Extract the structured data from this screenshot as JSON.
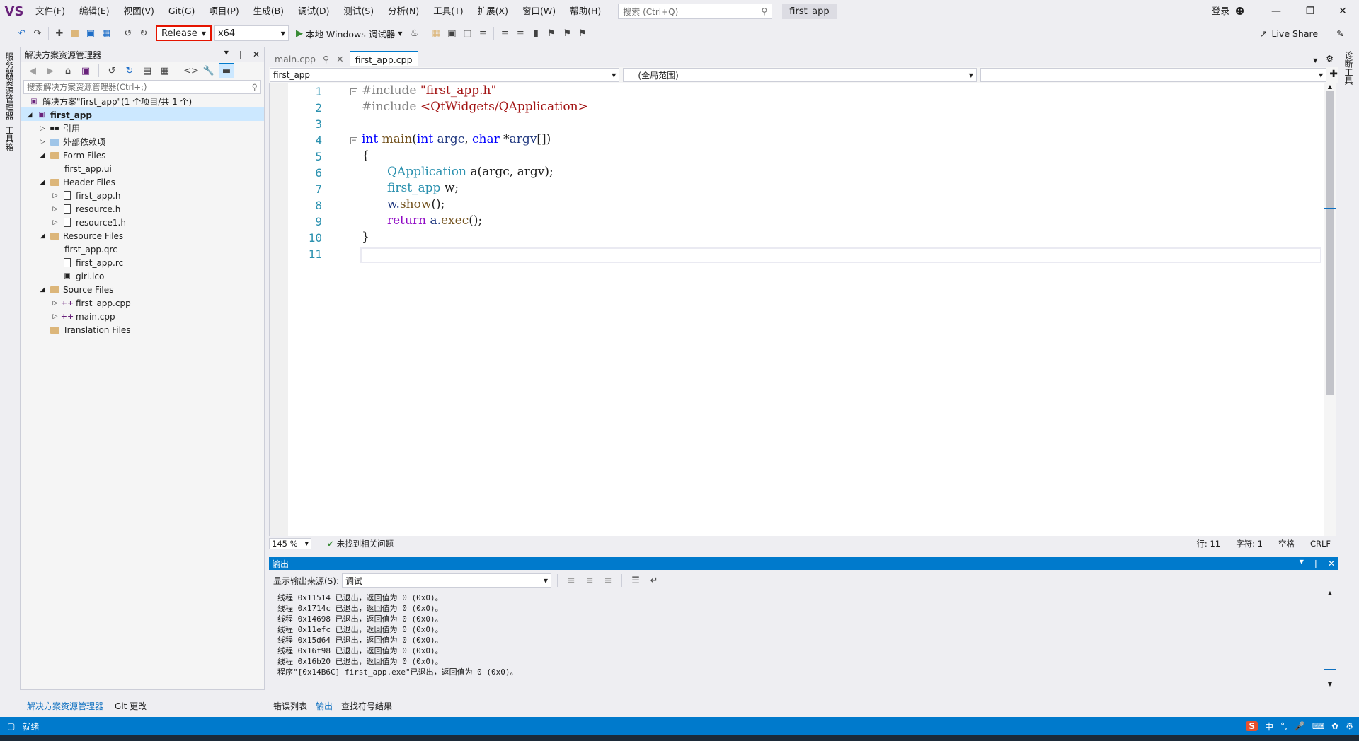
{
  "menubar": {
    "logo": "VS",
    "items": [
      "文件(F)",
      "编辑(E)",
      "视图(V)",
      "Git(G)",
      "项目(P)",
      "生成(B)",
      "调试(D)",
      "测试(S)",
      "分析(N)",
      "工具(T)",
      "扩展(X)",
      "窗口(W)",
      "帮助(H)"
    ],
    "search_placeholder": "搜索 (Ctrl+Q)",
    "app_title": "first_app",
    "login": "登录"
  },
  "toolbar": {
    "config": "Release",
    "platform": "x64",
    "run_label": "本地 Windows 调试器",
    "live_share": "Live Share"
  },
  "left_strip": {
    "tab1": "服务器资源管理器",
    "tab2": "工具箱"
  },
  "right_strip": {
    "tab1": "诊断工具"
  },
  "solution_explorer": {
    "title": "解决方案资源管理器",
    "search_placeholder": "搜索解决方案资源管理器(Ctrl+;)",
    "solution_label": "解决方案\"first_app\"(1 个项目/共 1 个)",
    "project": "first_app",
    "nodes": {
      "refs": "引用",
      "ext_deps": "外部依赖项",
      "form_files": "Form Files",
      "first_app_ui": "first_app.ui",
      "header_files": "Header Files",
      "first_app_h": "first_app.h",
      "resource_h": "resource.h",
      "resource1_h": "resource1.h",
      "resource_files": "Resource Files",
      "first_app_qrc": "first_app.qrc",
      "first_app_rc": "first_app.rc",
      "girl_ico": "girl.ico",
      "source_files": "Source Files",
      "first_app_cpp": "first_app.cpp",
      "main_cpp": "main.cpp",
      "translation_files": "Translation Files"
    },
    "bottom_tabs": [
      "解决方案资源管理器",
      "Git 更改"
    ]
  },
  "editor": {
    "tabs": [
      "main.cpp",
      "first_app.cpp"
    ],
    "nav_project": "first_app",
    "nav_scope": "(全局范围)",
    "line_numbers": [
      "1",
      "2",
      "3",
      "4",
      "5",
      "6",
      "7",
      "8",
      "9",
      "10",
      "11"
    ],
    "code": {
      "l1_pp": "#include",
      "l1_str": "\"first_app.h\"",
      "l2_pp": "#include",
      "l2_str": "<QtWidgets/QApplication>",
      "l4_int": "int",
      "l4_main": "main",
      "l4_open": "(",
      "l4_int2": "int",
      "l4_argc": "argc",
      "l4_comma": ", ",
      "l4_char": "char",
      "l4_star": " *",
      "l4_argv": "argv",
      "l4_close": "[])",
      "l5": "{",
      "l6_type": "QApplication",
      "l6_rest": "a(argc, argv);",
      "l7_type": "first_app",
      "l7_rest": "w;",
      "l8_w": "w.",
      "l8_show": "show",
      "l8_rest": "();",
      "l9_ret": "return",
      "l9_a": "a.",
      "l9_exec": "exec",
      "l9_rest": "();",
      "l10": "}"
    },
    "zoom": "145 %",
    "issues": "未找到相关问题",
    "line": "行: 11",
    "char": "字符: 1",
    "spaces": "空格",
    "eol": "CRLF"
  },
  "output": {
    "title": "输出",
    "source_label": "显示输出来源(S):",
    "source_value": "调试",
    "lines": [
      "线程 0x11514 已退出，返回值为 0 (0x0)。",
      "线程 0x1714c 已退出，返回值为 0 (0x0)。",
      "线程 0x14698 已退出，返回值为 0 (0x0)。",
      "线程 0x11efc 已退出，返回值为 0 (0x0)。",
      "线程 0x15d64 已退出，返回值为 0 (0x0)。",
      "线程 0x16f98 已退出，返回值为 0 (0x0)。",
      "线程 0x16b20 已退出，返回值为 0 (0x0)。",
      "程序\"[0x14B6C] first_app.exe\"已退出，返回值为 0 (0x0)。"
    ],
    "tabs": [
      "错误列表",
      "输出",
      "查找符号结果"
    ]
  },
  "statusbar": {
    "text": "就绪",
    "ime": "中"
  },
  "colors": {
    "accent": "#007acc",
    "keyword": "#0000ff",
    "string": "#a31515",
    "type": "#2b91af"
  }
}
